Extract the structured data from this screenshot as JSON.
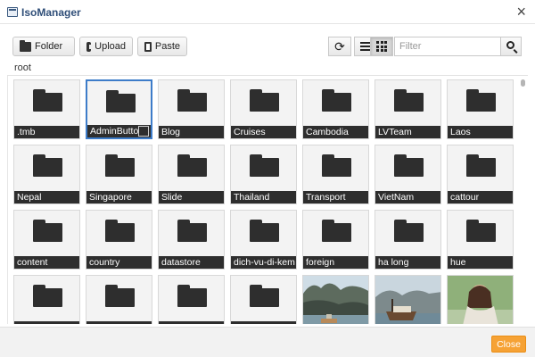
{
  "window": {
    "title": "IsoManager"
  },
  "toolbar": {
    "folder_label": "Folder",
    "upload_label": "Upload",
    "paste_label": "Paste",
    "filter_placeholder": "Filter",
    "active_view": "grid"
  },
  "breadcrumb": "root",
  "items": [
    {
      "name": ".tmb",
      "type": "folder"
    },
    {
      "name": "AdminButton",
      "type": "folder",
      "selected": true
    },
    {
      "name": "Blog",
      "type": "folder"
    },
    {
      "name": "Cruises",
      "type": "folder"
    },
    {
      "name": "Cambodia",
      "type": "folder"
    },
    {
      "name": "LVTeam",
      "type": "folder"
    },
    {
      "name": "Laos",
      "type": "folder"
    },
    {
      "name": "Nepal",
      "type": "folder"
    },
    {
      "name": "Singapore",
      "type": "folder"
    },
    {
      "name": "Slide",
      "type": "folder"
    },
    {
      "name": "Thailand",
      "type": "folder"
    },
    {
      "name": "Transport",
      "type": "folder"
    },
    {
      "name": "VietNam",
      "type": "folder"
    },
    {
      "name": "cattour",
      "type": "folder"
    },
    {
      "name": "content",
      "type": "folder"
    },
    {
      "name": "country",
      "type": "folder"
    },
    {
      "name": "datastore",
      "type": "folder"
    },
    {
      "name": "dich-vu-di-kem",
      "type": "folder"
    },
    {
      "name": "foreign",
      "type": "folder"
    },
    {
      "name": "ha long",
      "type": "folder"
    },
    {
      "name": "hue",
      "type": "folder"
    },
    {
      "name": "",
      "type": "folder"
    },
    {
      "name": "",
      "type": "folder"
    },
    {
      "name": "",
      "type": "folder"
    },
    {
      "name": "",
      "type": "folder"
    },
    {
      "name": "",
      "type": "image",
      "picture": "bay-karst-boat"
    },
    {
      "name": "",
      "type": "image",
      "picture": "junk-boat-bay"
    },
    {
      "name": "",
      "type": "image",
      "picture": "woman-portrait"
    }
  ],
  "footer": {
    "close_label": "Close"
  },
  "colors": {
    "accent": "#f6a235",
    "title": "#2f4e78",
    "selection": "#3d7cc9",
    "tile_label_bg": "#2e2e2e"
  }
}
